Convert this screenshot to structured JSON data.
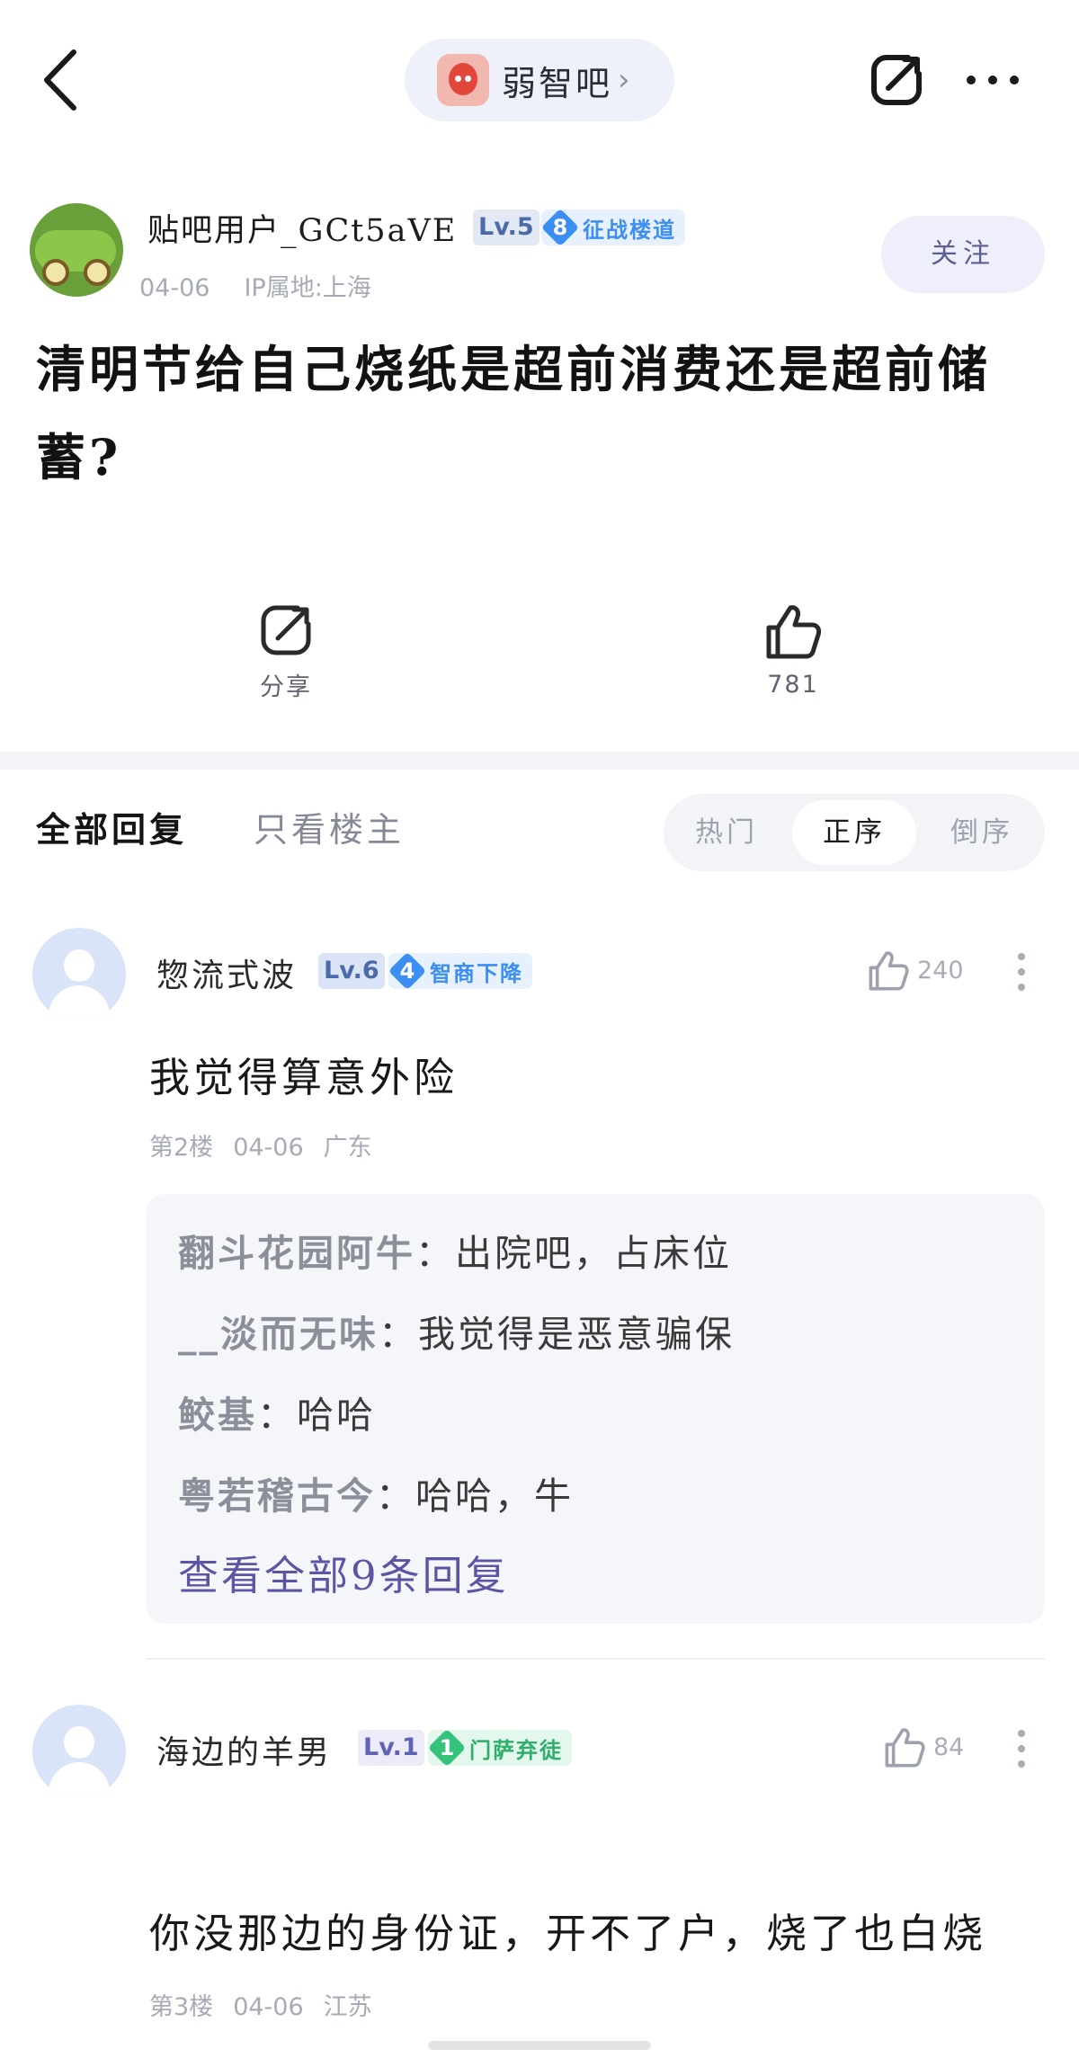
{
  "header": {
    "forum_name": "弱智吧",
    "forum_chevron": "›"
  },
  "post": {
    "author": {
      "name": "贴吧用户_GCt5aVE",
      "level": "Lv.5",
      "title_number": "8",
      "title_text": "征战楼道",
      "date": "04-06",
      "ip_location": "IP属地:上海"
    },
    "follow_label": "关注",
    "title": "清明节给自己烧纸是超前消费还是超前储蓄?",
    "share_label": "分享",
    "like_count": "781"
  },
  "tabs": {
    "all": "全部回复",
    "op_only": "只看楼主"
  },
  "sort": {
    "options": [
      "热门",
      "正序",
      "倒序"
    ],
    "selected": "正序"
  },
  "replies": [
    {
      "user": "惣流式波",
      "level": "Lv.6",
      "title_number": "4",
      "title_text": "智商下降",
      "likes": "240",
      "text": "我觉得算意外险",
      "floor": "第2楼",
      "date": "04-06",
      "location": "广东",
      "sub_replies": [
        {
          "who": "翻斗花园阿牛",
          "text": "出院吧，占床位"
        },
        {
          "who": "__淡而无味",
          "text": "我觉得是恶意骗保"
        },
        {
          "who": "鲛基",
          "text": "哈哈"
        },
        {
          "who": "粤若稽古今",
          "text": "哈哈，牛"
        }
      ],
      "view_all": "查看全部9条回复"
    },
    {
      "user": "海边的羊男",
      "level": "Lv.1",
      "title_number": "1",
      "title_text": "门萨弃徒",
      "likes": "84",
      "text": "你没那边的身份证，开不了户，烧了也白烧",
      "floor": "第3楼",
      "date": "04-06",
      "location": "江苏"
    }
  ],
  "colors": {
    "accent_purple": "#5b55a6",
    "badge_blue": "#3d8ef3",
    "badge_green": "#35c27a",
    "level_bg": "#e3e8f5"
  },
  "icons": {
    "back": "chevron-left-icon",
    "share": "share-icon",
    "more": "more-horizontal-icon",
    "like": "thumbs-up-icon"
  }
}
